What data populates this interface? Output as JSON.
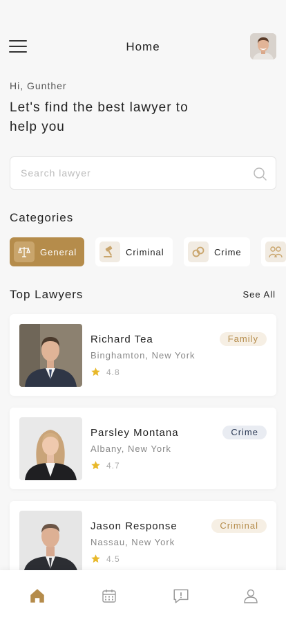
{
  "header": {
    "title": "Home"
  },
  "greeting": "Hi, Gunther",
  "headline": "Let's find the best lawyer to help you",
  "search": {
    "placeholder": "Search lawyer",
    "value": ""
  },
  "categories": {
    "title": "Categories",
    "items": [
      {
        "label": "General",
        "icon": "scales-icon",
        "active": true
      },
      {
        "label": "Criminal",
        "icon": "gavel-icon",
        "active": false
      },
      {
        "label": "Crime",
        "icon": "handcuffs-icon",
        "active": false
      },
      {
        "label": "",
        "icon": "family-icon",
        "active": false
      }
    ]
  },
  "top_lawyers": {
    "title": "Top Lawyers",
    "see_all": "See All",
    "items": [
      {
        "name": "Richard Tea",
        "location": "Binghamton, New York",
        "rating": "4.8",
        "badge": "Family"
      },
      {
        "name": "Parsley Montana",
        "location": "Albany, New York",
        "rating": "4.7",
        "badge": "Crime"
      },
      {
        "name": "Jason Response",
        "location": "Nassau, New York",
        "rating": "4.5",
        "badge": "Criminal"
      }
    ]
  },
  "tabbar": {
    "items": [
      {
        "icon": "home-icon",
        "active": true
      },
      {
        "icon": "calendar-icon",
        "active": false
      },
      {
        "icon": "chat-alert-icon",
        "active": false
      },
      {
        "icon": "profile-icon",
        "active": false
      }
    ]
  },
  "colors": {
    "accent": "#b58c4b",
    "family_badge_bg": "#f6efe4",
    "family_badge_text": "#b58c4b",
    "crime_badge_bg": "#e9ecf2",
    "crime_badge_text": "#2c3a55",
    "criminal_badge_bg": "#f6efe4",
    "criminal_badge_text": "#b58c4b",
    "star": "#e8b82a"
  }
}
